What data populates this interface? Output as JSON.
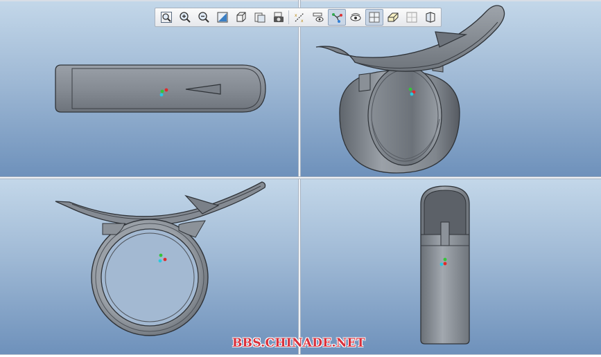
{
  "watermark": "BBS.CHINADE.NET",
  "toolbar": {
    "buttons": [
      {
        "icon": "zoom-window-icon"
      },
      {
        "icon": "zoom-in-icon"
      },
      {
        "icon": "zoom-out-icon"
      },
      {
        "icon": "refit-icon"
      },
      {
        "icon": "display-style-icon"
      },
      {
        "icon": "saved-views-icon"
      },
      {
        "icon": "snapshot-icon"
      },
      {
        "icon": "datum-display-icon"
      },
      {
        "icon": "annotation-display-icon"
      },
      {
        "icon": "spin-center-icon",
        "active": true
      },
      {
        "icon": "view-manager-icon"
      },
      {
        "icon": "four-view-icon",
        "active": true
      },
      {
        "icon": "reorient-icon"
      },
      {
        "icon": "single-view-icon"
      },
      {
        "icon": "section-icon"
      }
    ]
  },
  "viewports": [
    {
      "name": "front-view"
    },
    {
      "name": "isometric-view"
    },
    {
      "name": "side-view"
    },
    {
      "name": "right-view"
    }
  ],
  "colors": {
    "part_fill": "#7f858d",
    "part_edge": "#2f3338",
    "background_top": "#c3d7e9",
    "background_bottom": "#6e91bb"
  }
}
